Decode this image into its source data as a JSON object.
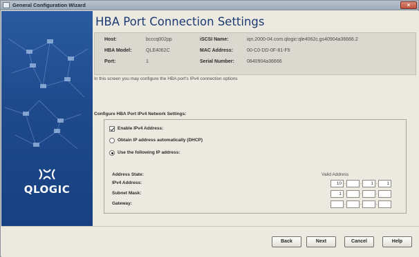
{
  "window": {
    "title": "General Configuration Wizard",
    "close_glyph": "×"
  },
  "logo": {
    "text": "QLOGIC",
    "icon": "qlogic-mark"
  },
  "page": {
    "title": "HBA Port Connection Settings",
    "info": {
      "host_label": "Host:",
      "host_value": "bcccq002pp",
      "hba_model_label": "HBA Model:",
      "hba_model_value": "QLE4062C",
      "port_label": "Port:",
      "port_value": "1",
      "iscsi_name_label": "iSCSI Name:",
      "iscsi_name_value": "iqn.2000-04.com.qlogic:qle4062c.gs40904a36666.2",
      "mac_label": "MAC Address:",
      "mac_value": "00-C0-DD-0F-81-F9",
      "serial_label": "Serial Number:",
      "serial_value": "0840904a36666"
    },
    "intro": "In this screen you may configure the HBA port's IPv4 connection options",
    "section_title": "Configure HBA Port IPv4 Network Settings:",
    "enable_ipv4_label": "Enable IPv4 Address:",
    "dhcp_label": "Obtain IP address automatically (DHCP)",
    "manual_label": "Use the following IP address:",
    "address_state_label": "Address State:",
    "valid_address_label": "Valid Address",
    "ipv4_label": "IPv4 Address:",
    "subnet_label": "Subnet Mask:",
    "gateway_label": "Gateway:",
    "ipv4_octets": [
      "10",
      "",
      "1",
      "1"
    ],
    "subnet_octets": [
      "1",
      "",
      "",
      ""
    ],
    "gateway_octets": [
      "",
      "",
      "",
      ""
    ]
  },
  "buttons": {
    "back": "Back",
    "next": "Next",
    "cancel": "Cancel",
    "help": "Help"
  }
}
